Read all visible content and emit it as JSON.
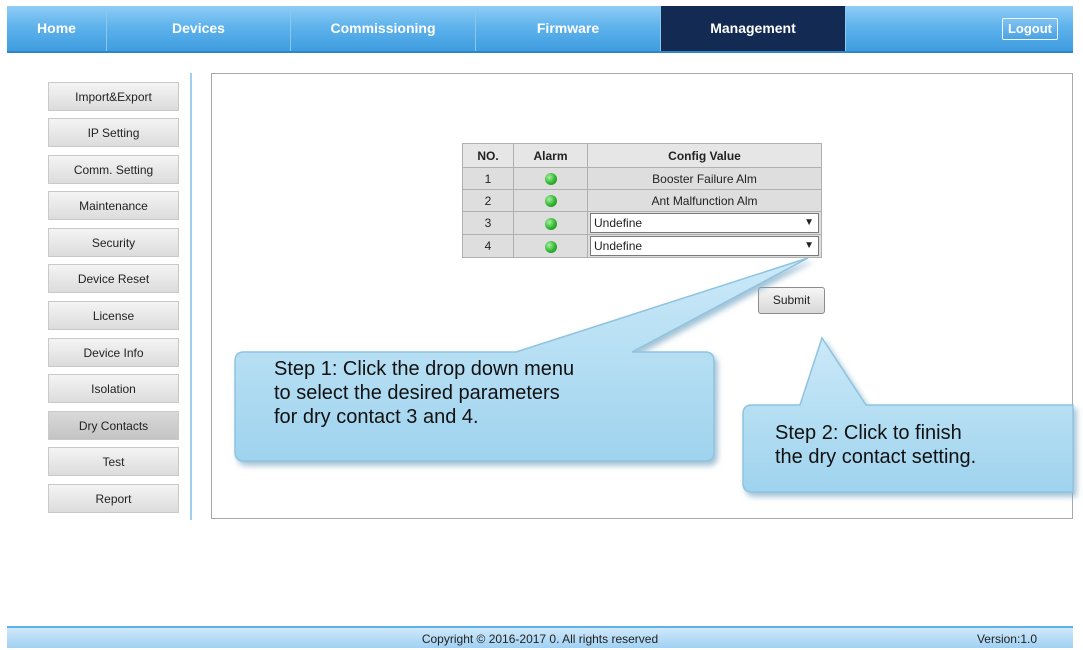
{
  "nav": {
    "tabs": [
      {
        "label": "Home"
      },
      {
        "label": "Devices"
      },
      {
        "label": "Commissioning"
      },
      {
        "label": "Firmware"
      },
      {
        "label": "Management"
      }
    ],
    "active_tab": "Management",
    "logout_label": "Logout"
  },
  "sidebar": {
    "items": [
      {
        "label": "Import&Export"
      },
      {
        "label": "IP Setting"
      },
      {
        "label": "Comm. Setting"
      },
      {
        "label": "Maintenance"
      },
      {
        "label": "Security"
      },
      {
        "label": "Device Reset"
      },
      {
        "label": "License"
      },
      {
        "label": "Device Info"
      },
      {
        "label": "Isolation"
      },
      {
        "label": "Dry Contacts"
      },
      {
        "label": "Test"
      },
      {
        "label": "Report"
      }
    ],
    "active_item": "Dry Contacts"
  },
  "table": {
    "headers": [
      "NO.",
      "Alarm",
      "Config Value"
    ],
    "rows": [
      {
        "no": "1",
        "config": "Booster Failure Alm",
        "editable": false
      },
      {
        "no": "2",
        "config": "Ant Malfunction Alm",
        "editable": false
      },
      {
        "no": "3",
        "config": "Undefine",
        "editable": true
      },
      {
        "no": "4",
        "config": "Undefine",
        "editable": true
      }
    ],
    "alarm_icon": "green-led-icon",
    "dropdown_icon": "chevron-down-icon"
  },
  "submit_label": "Submit",
  "callouts": {
    "step1": [
      "Step 1: Click the drop down menu",
      "to select the desired parameters",
      "for dry contact 3 and 4."
    ],
    "step2": [
      "Step 2: Click to finish",
      "the dry contact setting."
    ]
  },
  "footer": {
    "copyright": "Copyright © 2016-2017 0. All rights reserved",
    "version": "Version:1.0"
  },
  "colors": {
    "nav_blue": "#5fb3ec",
    "nav_active": "#132a52",
    "callout_fill": "#b9dff3",
    "led_green": "#2fb52f"
  }
}
